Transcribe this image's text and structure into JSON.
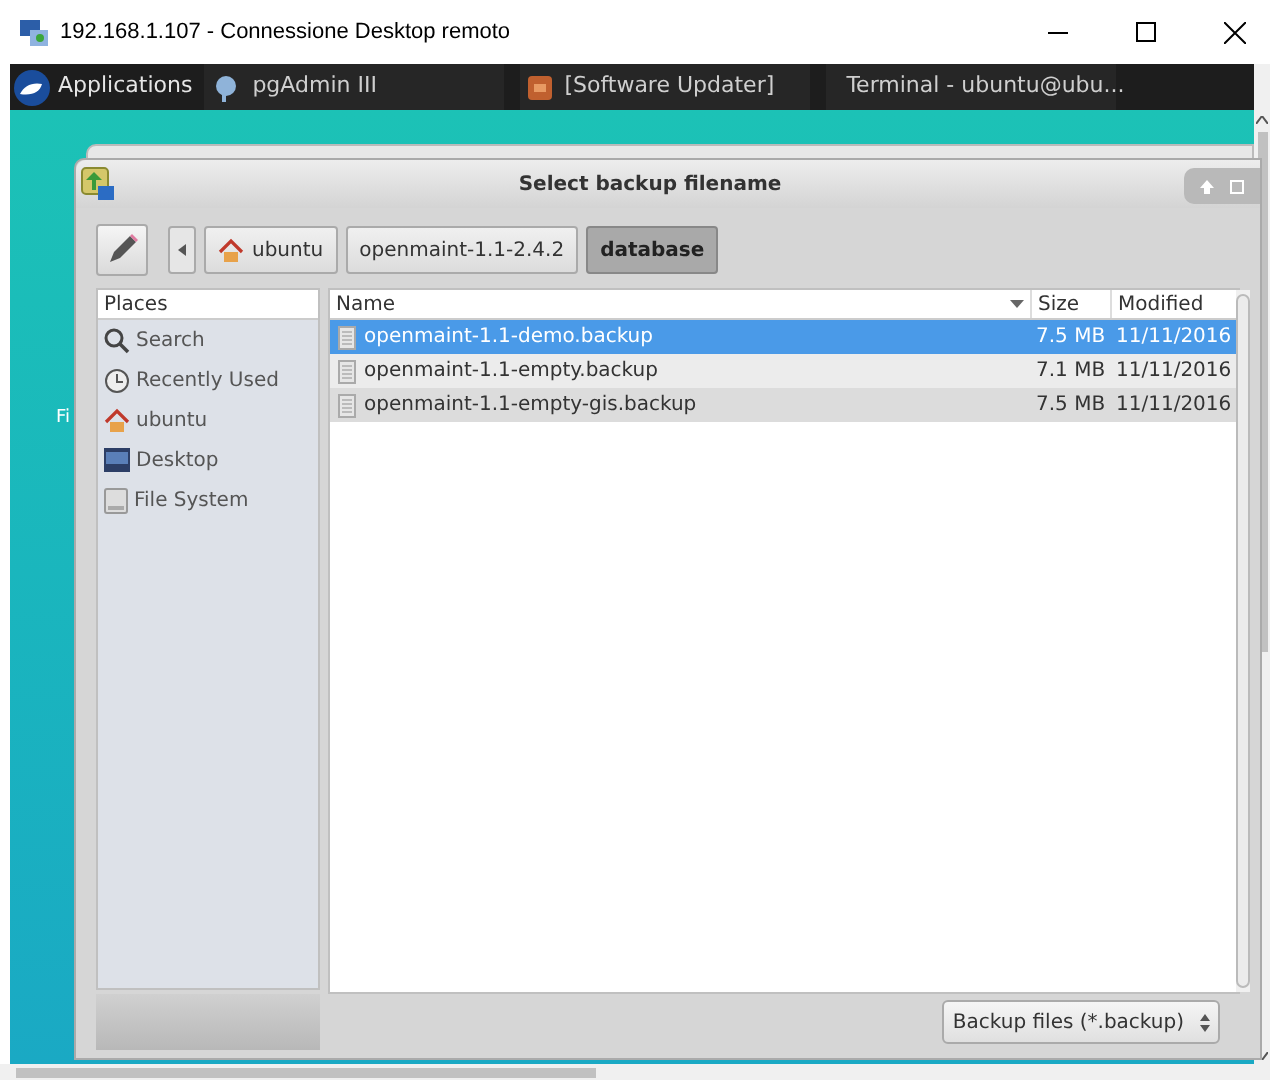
{
  "window": {
    "title": "192.168.1.107 - Connessione Desktop remoto"
  },
  "taskbar": {
    "menu": "Applications",
    "tasks": [
      {
        "label": "pgAdmin III",
        "kind": "db"
      },
      {
        "label": "[Software Updater]",
        "kind": "updater"
      },
      {
        "label": "Terminal - ubuntu@ubu...",
        "kind": "terminal"
      }
    ]
  },
  "desktop": {
    "icon_label": "Fi"
  },
  "dialog": {
    "title": "Select backup filename",
    "path": [
      {
        "label": "ubuntu",
        "home": true,
        "selected": false
      },
      {
        "label": "openmaint-1.1-2.4.2",
        "home": false,
        "selected": false
      },
      {
        "label": "database",
        "home": false,
        "selected": true
      }
    ],
    "places": {
      "heading": "Places",
      "items": [
        {
          "label": "Search",
          "kind": "search"
        },
        {
          "label": "Recently Used",
          "kind": "recent"
        },
        {
          "label": "ubuntu",
          "kind": "home"
        },
        {
          "label": "Desktop",
          "kind": "desktop"
        },
        {
          "label": "File System",
          "kind": "disk"
        }
      ]
    },
    "columns": [
      "Name",
      "Size",
      "Modified"
    ],
    "rows": [
      {
        "name": "openmaint-1.1-demo.backup",
        "size": "7.5 MB",
        "modified": "11/11/2016",
        "selected": true
      },
      {
        "name": "openmaint-1.1-empty.backup",
        "size": "7.1 MB",
        "modified": "11/11/2016",
        "selected": false
      },
      {
        "name": "openmaint-1.1-empty-gis.backup",
        "size": "7.5 MB",
        "modified": "11/11/2016",
        "selected": false
      }
    ],
    "filter": "Backup files (*.backup)"
  }
}
